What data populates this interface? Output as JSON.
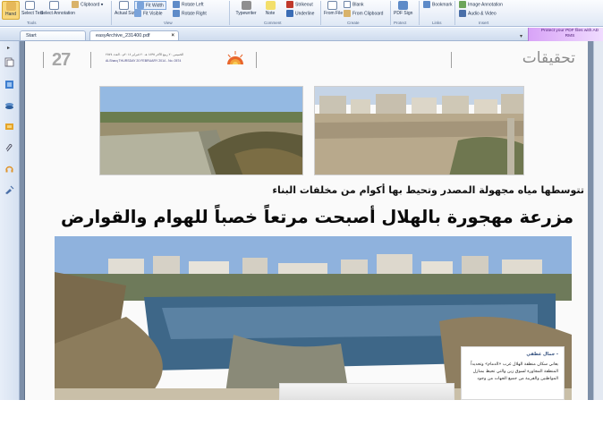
{
  "ribbon": {
    "tools": {
      "hand": "Hand",
      "select_text": "Select Text",
      "select_annotation": "Select Annotation",
      "group": "Tools"
    },
    "clipboard": "Clipboard",
    "view": {
      "actual_size": "Actual Size",
      "fit_width": "Fit Width",
      "fit_visible": "Fit Visible",
      "rotate_left": "Rotate Left",
      "rotate_right": "Rotate Right",
      "group": "View"
    },
    "comment": {
      "typewriter": "Typewriter",
      "note": "Note",
      "strikeout": "Strikeout",
      "underline": "Underline",
      "group": "Comment"
    },
    "create": {
      "from_file": "From File",
      "blank": "Blank",
      "from_clipboard": "From Clipboard",
      "group": "Create"
    },
    "protect": {
      "pdf_sign": "PDF Sign",
      "group": "Protect"
    },
    "links": {
      "bookmark": "Bookmark",
      "group": "Links"
    },
    "insert": {
      "image_annotation": "Image Annotation",
      "audio_video": "Audio & Video",
      "group": "Insert"
    }
  },
  "tabs": {
    "start": "Start",
    "document": "easyArchive_231400.pdf",
    "close": "×"
  },
  "promo": "Protect your PDF files with AD RMS",
  "page": {
    "number": "27",
    "header_line1": "الخميس ٢٠ ربيع الآخر ١٤٣٥ هـ ٢٠ فبراير ٢٠١٤م - العدد ٢٥٧٤",
    "header_line2": "Al-Sharq  THURSDAY 20 FEBRUARY 2014 - No. 0574",
    "section": "تحقيقات",
    "subheadline": "تتوسطها مياه مجهولة المصدر وتحيط بها أكوام من مخلفات البناء",
    "headline": "مزرعة مهجورة بالهلال أصبحت مرتعاً خصباً للهوام والقوارض",
    "byline": "جمال غطفي - ",
    "body": "يعاني سكان منطقة الهلال غرب «الدمام» وتحديداً المنطقة المجاورة لسوق زين والتي تحيط بمنازل المواطنين والقريبة من جميع الجهات من وجود"
  },
  "colors": {
    "ribbon_top": "#fbfcfe",
    "ribbon_bottom": "#dfe8f5",
    "doc_bg": "#7d8fa8",
    "sky": "#8fb2dd",
    "water": "#3e6788"
  }
}
